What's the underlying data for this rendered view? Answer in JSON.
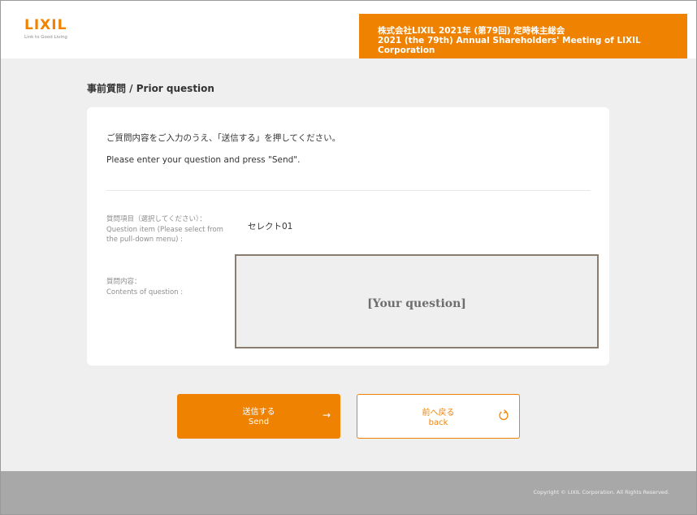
{
  "header": {
    "logo": "LIXIL",
    "tagline": "Link to Good Living",
    "meeting_title_jp": "株式会社LIXIL 2021年 (第79回) 定時株主総会",
    "meeting_title_en": "2021 (the 79th) Annual Shareholders' Meeting of LIXIL Corporation",
    "accent_color": "#ef8200"
  },
  "page": {
    "title": "事前質問 / Prior question"
  },
  "form": {
    "instruction_jp": "ご質問内容をご入力のうえ、「送信する」を押してください。",
    "instruction_en": "Please enter your question and press \"Send\".",
    "question_item_label_jp": "質問項目（選択してください）：",
    "question_item_label_en": "Question item (Please select from the pull-down menu) :",
    "question_item_value": "セレクト01",
    "contents_label_jp": "質問内容：",
    "contents_label_en": "Contents of question :",
    "contents_value": "[Your question]"
  },
  "buttons": {
    "send_jp": "送信する",
    "send_en": "Send",
    "send_icon": "arrow-right-icon",
    "back_jp": "前へ戻る",
    "back_en": "back",
    "back_icon": "reload-icon"
  },
  "footer": {
    "copyright": "Copyright © LIXIL Corporation. All Rights Reserved."
  }
}
